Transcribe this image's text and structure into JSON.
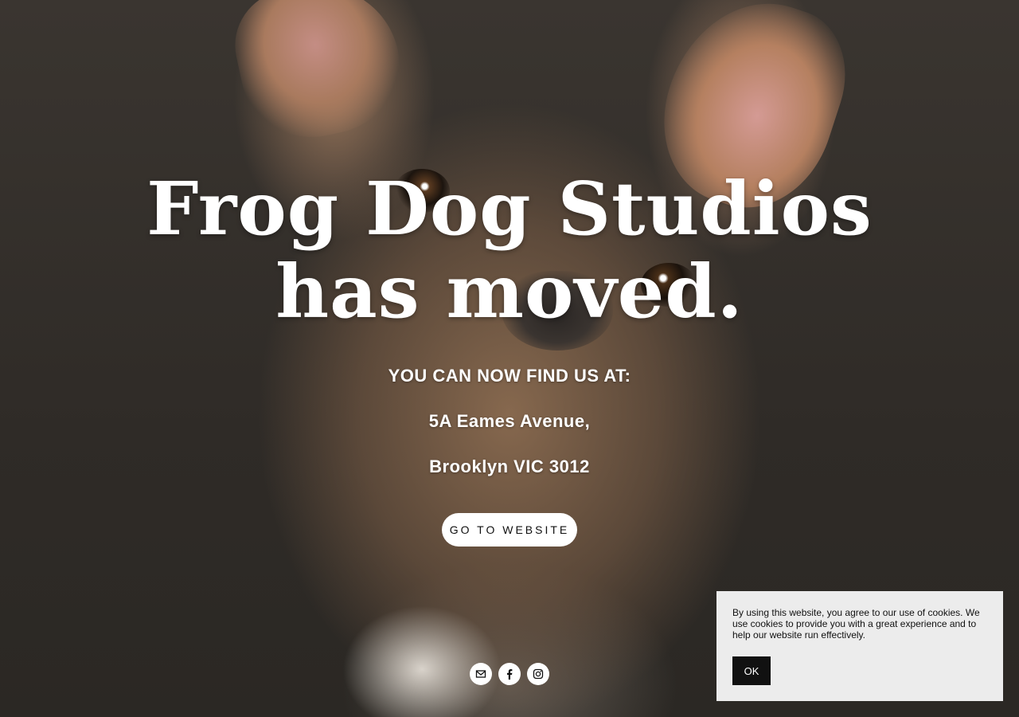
{
  "headline": {
    "line1": "Frog Dog Studios",
    "line2": "has moved."
  },
  "subhead": "YOU CAN NOW FIND US AT:",
  "address": {
    "line1": "5A Eames Avenue,",
    "line2": "Brooklyn VIC 3012"
  },
  "cta_label": "GO TO WEBSITE",
  "social_icons": [
    "mail-icon",
    "facebook-icon",
    "instagram-icon"
  ],
  "cookie": {
    "text": "By using this website, you agree to our use of cookies. We use cookies to provide you with a great experience and to help our website run effectively.",
    "ok_label": "OK"
  },
  "colors": {
    "text": "#ffffff",
    "button_bg": "#ffffff",
    "button_text": "#111111",
    "cookie_bg": "#ececec",
    "cookie_button_bg": "#111111"
  }
}
